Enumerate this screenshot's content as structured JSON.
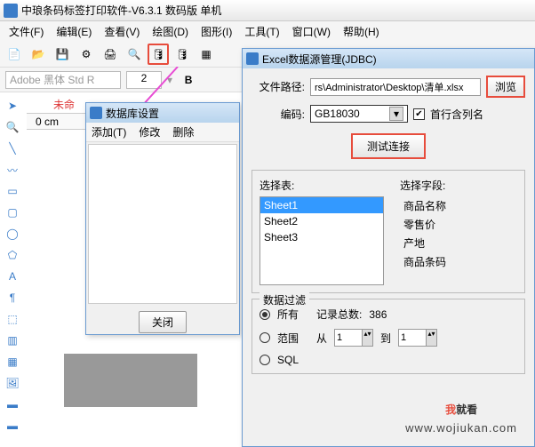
{
  "app": {
    "title": "中琅条码标签打印软件-V6.3.1 数码版 单机"
  },
  "menu": {
    "file": "文件(F)",
    "edit": "编辑(E)",
    "view": "查看(V)",
    "draw": "绘图(D)",
    "shape": "图形(I)",
    "tool": "工具(T)",
    "window": "窗口(W)",
    "help": "帮助(H)"
  },
  "toolbar2": {
    "font": "Adobe 黑体 Std R",
    "size": "2",
    "b": "B"
  },
  "canvas": {
    "tab": "未命",
    "ruler": "0 cm"
  },
  "dbdlg": {
    "title": "数据库设置",
    "add": "添加(T)",
    "mod": "修改",
    "del": "删除",
    "close": "关闭"
  },
  "excel": {
    "title": "Excel数据源管理(JDBC)",
    "pathlbl": "文件路径:",
    "path": "rs\\Administrator\\Desktop\\清单.xlsx",
    "browse": "浏览",
    "enclbl": "编码:",
    "enc": "GB18030",
    "firstrow": "首行含列名",
    "test": "测试连接",
    "tbl": "选择表:",
    "fld": "选择字段:",
    "sheets": [
      "Sheet1",
      "Sheet2",
      "Sheet3"
    ],
    "fields": [
      "商品名称",
      "零售价",
      "产地",
      "商品条码"
    ],
    "filter": "数据过滤",
    "all": "所有",
    "totlbl": "记录总数:",
    "tot": "386",
    "range": "范围",
    "from": "从",
    "to": "到",
    "fromv": "1",
    "tov": "1",
    "sql": "SQL"
  },
  "wm": {
    "a": "我",
    "b": "就看",
    "url": "www.wojiukan.com"
  }
}
